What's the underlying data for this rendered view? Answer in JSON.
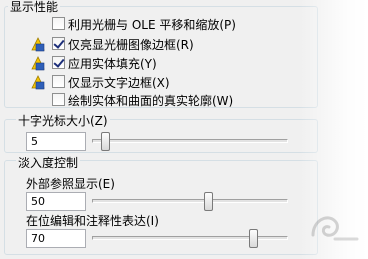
{
  "display_performance": {
    "title": "显示性能",
    "options": [
      {
        "label": "利用光栅与 OLE 平移和缩放(P)",
        "checked": false,
        "has_icon": false
      },
      {
        "label": "仅亮显光栅图像边框(R)",
        "checked": true,
        "has_icon": true
      },
      {
        "label": "应用实体填充(Y)",
        "checked": true,
        "has_icon": true
      },
      {
        "label": "仅显示文字边框(X)",
        "checked": false,
        "has_icon": true
      },
      {
        "label": "绘制实体和曲面的真实轮廓(W)",
        "checked": false,
        "has_icon": false
      }
    ]
  },
  "crosshair": {
    "title": "十字光标大小(Z)",
    "value": "5",
    "slider_fraction": 0.05
  },
  "fade_control": {
    "title": "淡入度控制",
    "xref": {
      "label": "外部参照显示(E)",
      "value": "50",
      "slider_fraction": 0.5
    },
    "inplace": {
      "label": "在位编辑和注释性表达(I)",
      "value": "70",
      "slider_fraction": 0.7
    }
  },
  "colors": {
    "group_border": "#d5dfe5",
    "check_mark": "#1d2f7a",
    "icon_yellow": "#f5c400",
    "icon_blue": "#2f5fb8"
  }
}
